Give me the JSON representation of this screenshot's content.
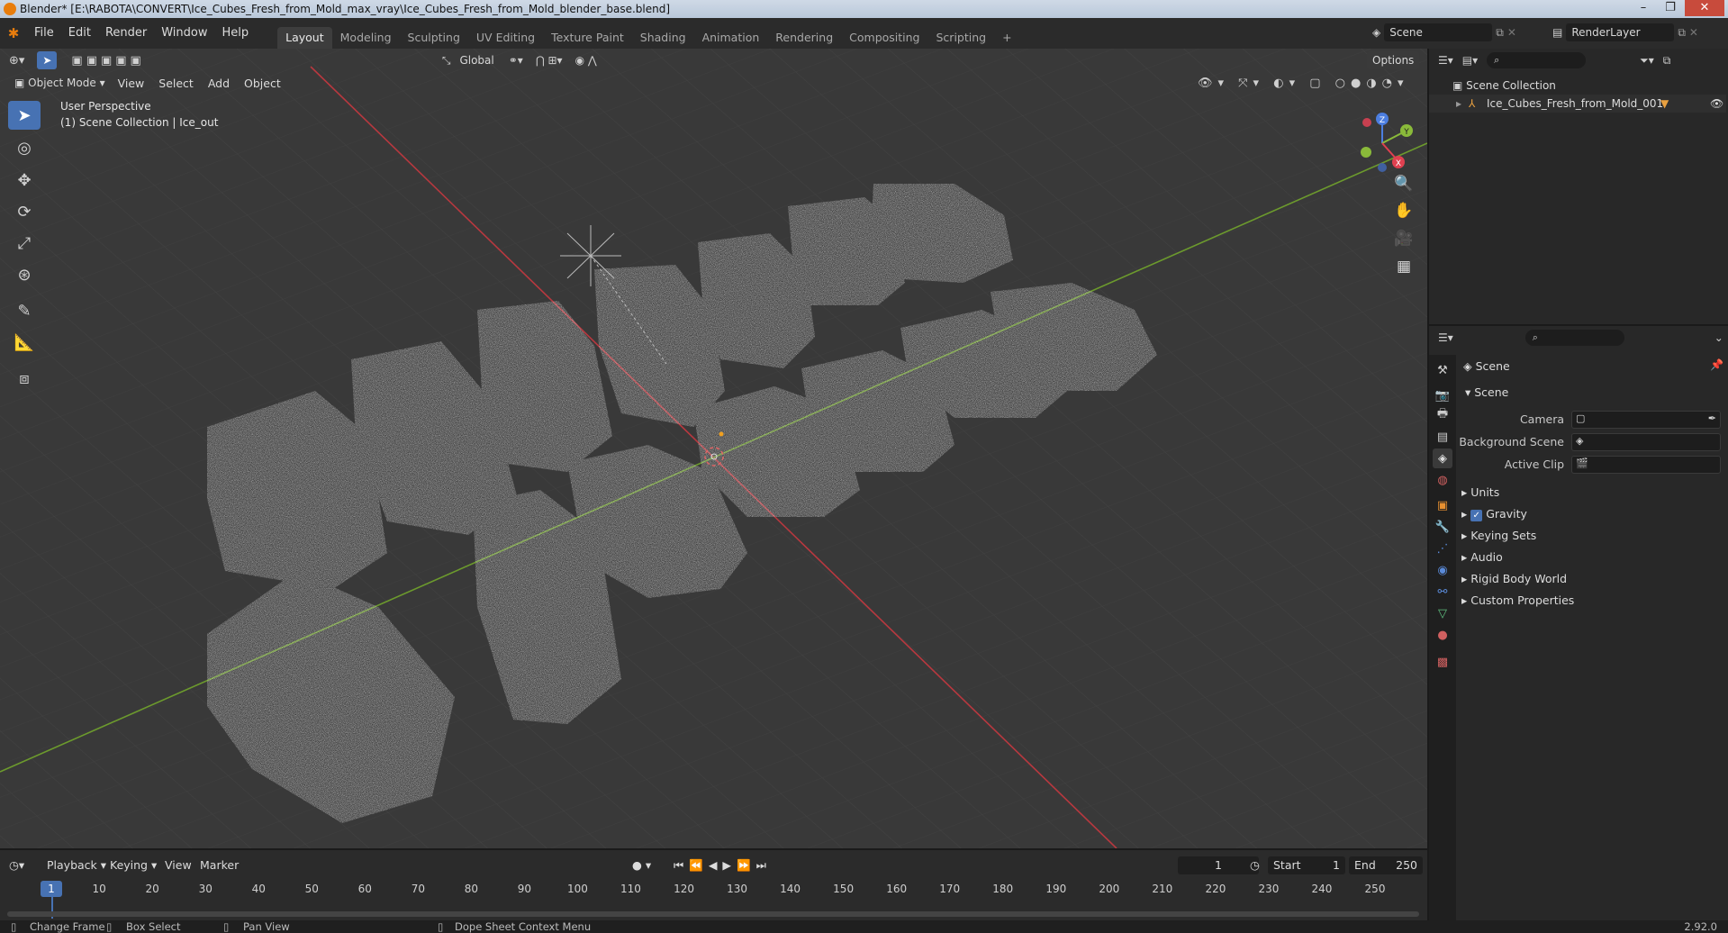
{
  "window": {
    "title": "Blender* [E:\\RABOTA\\CONVERT\\Ice_Cubes_Fresh_from_Mold_max_vray\\Ice_Cubes_Fresh_from_Mold_blender_base.blend]",
    "controls": [
      "–",
      "❐",
      "✕"
    ]
  },
  "menubar": {
    "items": [
      "File",
      "Edit",
      "Render",
      "Window",
      "Help"
    ],
    "workspaces": [
      "Layout",
      "Modeling",
      "Sculpting",
      "UV Editing",
      "Texture Paint",
      "Shading",
      "Animation",
      "Rendering",
      "Compositing",
      "Scripting"
    ],
    "active_workspace": "Layout",
    "add_tab": "+",
    "scene": "Scene",
    "view_layer": "RenderLayer"
  },
  "viewport": {
    "transform_orientation": "Global",
    "options_label": "Options",
    "mode": "Object Mode",
    "menus": [
      "View",
      "Select",
      "Add",
      "Object"
    ],
    "info_line1": "User Perspective",
    "info_line2": "(1) Scene Collection | Ice_out",
    "gizmo_axes": {
      "x": "X",
      "y": "Y",
      "z": "Z"
    },
    "colors": {
      "background": "#393939",
      "x_axis": "#b8383f",
      "y_axis": "#6c9a2d",
      "active_tool": "#4772b3"
    }
  },
  "outliner": {
    "root": "Scene Collection",
    "items": [
      "Ice_Cubes_Fresh_from_Mold_001"
    ]
  },
  "properties": {
    "context_title": "Scene",
    "panel_title": "Scene",
    "fields": [
      {
        "label": "Camera",
        "value": ""
      },
      {
        "label": "Background Scene",
        "value": ""
      },
      {
        "label": "Active Clip",
        "value": ""
      }
    ],
    "subpanels": [
      "Units",
      "Gravity",
      "Keying Sets",
      "Audio",
      "Rigid Body World",
      "Custom Properties"
    ],
    "gravity_checked": true
  },
  "timeline": {
    "menus": [
      "Playback",
      "Keying",
      "View",
      "Marker"
    ],
    "current_frame": "1",
    "start_label": "Start",
    "start_value": "1",
    "end_label": "End",
    "end_value": "250",
    "ticks": [
      "1",
      "10",
      "20",
      "30",
      "40",
      "50",
      "60",
      "70",
      "80",
      "90",
      "100",
      "110",
      "120",
      "130",
      "140",
      "150",
      "160",
      "170",
      "180",
      "190",
      "200",
      "210",
      "220",
      "230",
      "240",
      "250"
    ]
  },
  "statusbar": {
    "items": [
      "Change Frame",
      "Box Select",
      "Pan View",
      "Dope Sheet Context Menu"
    ],
    "version": "2.92.0"
  }
}
